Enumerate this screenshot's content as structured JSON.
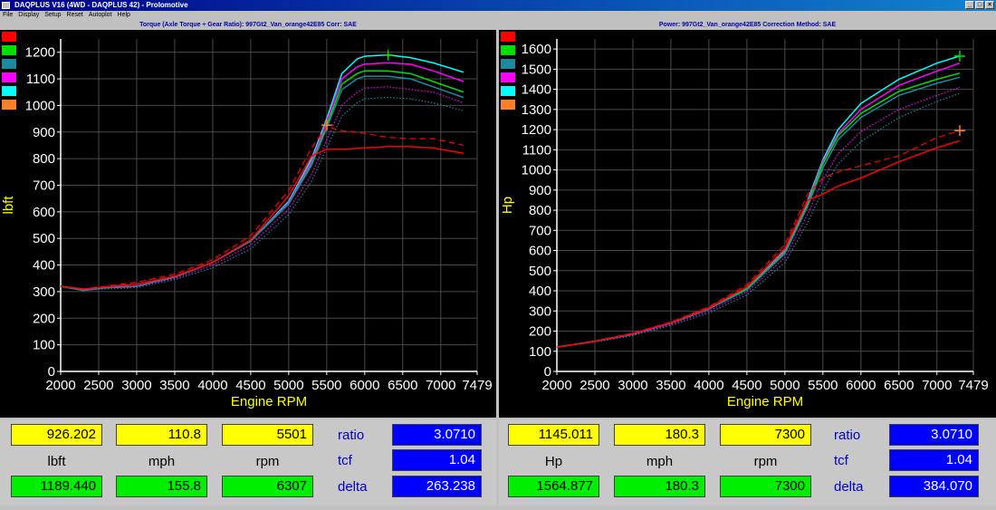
{
  "window": {
    "title": "DAQPLUS V16 (4WD - DAQPLUS 42) - Prolomotive",
    "buttons": [
      "_",
      "□",
      "×"
    ]
  },
  "menu": [
    "File",
    "Display",
    "Setup",
    "Reset",
    "Autoplot",
    "Help"
  ],
  "colors": {
    "red": "#ff0000",
    "green": "#00e000",
    "teal": "#1a8aa0",
    "magenta": "#ff00ff",
    "cyan": "#00ffff",
    "orange": "#ff7f27",
    "axis_label": "#ffff00",
    "tick_label": "#ffffff"
  },
  "swatches": [
    "#ff0000",
    "#00e000",
    "#1a8aa0",
    "#ff00ff",
    "#00ffff",
    "#ff7f27"
  ],
  "torque_chart": {
    "title": "Torque (Axle Torque ÷ Gear Ratio): 997Gt2_Van_orange42E85     Corr: SAE",
    "xlabel": "Engine RPM",
    "ylabel": "lbft"
  },
  "power_chart": {
    "title": "Power: 997Gt2_Van_orange42E85      Correction Method: SAE",
    "xlabel": "Engine RPM",
    "ylabel": "Hp"
  },
  "chart_data": [
    {
      "type": "line",
      "title": "Torque (Axle Torque ÷ Gear Ratio): 997Gt2_Van_orange42E85     Corr: SAE",
      "xlabel": "Engine RPM",
      "ylabel": "lbft",
      "xlim": [
        2000,
        7479
      ],
      "ylim": [
        0,
        1250
      ],
      "xticks": [
        "2000",
        "2500",
        "3000",
        "3500",
        "4000",
        "4500",
        "5000",
        "5500",
        "6000",
        "6500",
        "7000",
        "7479"
      ],
      "yticks": [
        "0",
        "100",
        "200",
        "300",
        "400",
        "500",
        "600",
        "700",
        "800",
        "900",
        "1000",
        "1100",
        "1200"
      ],
      "grid": true,
      "markers": [
        {
          "x": 5501,
          "y": 926,
          "color": "#ff7f27"
        },
        {
          "x": 6307,
          "y": 1189,
          "color": "#00e000"
        }
      ],
      "series": [
        {
          "color": "#00ffff",
          "style": "solid",
          "x": [
            2000,
            2300,
            2600,
            3000,
            3500,
            4000,
            4500,
            5000,
            5300,
            5500,
            5700,
            5900,
            6000,
            6300,
            6600,
            6900,
            7300
          ],
          "y": [
            320,
            305,
            315,
            320,
            355,
            410,
            490,
            640,
            800,
            950,
            1120,
            1175,
            1185,
            1190,
            1180,
            1160,
            1125
          ]
        },
        {
          "color": "#ff00ff",
          "style": "solid",
          "x": [
            2000,
            2300,
            2600,
            3000,
            3500,
            4000,
            4500,
            5000,
            5300,
            5500,
            5700,
            5900,
            6000,
            6300,
            6600,
            6900,
            7300
          ],
          "y": [
            320,
            305,
            315,
            320,
            355,
            410,
            490,
            635,
            790,
            940,
            1100,
            1145,
            1155,
            1160,
            1155,
            1130,
            1090
          ]
        },
        {
          "color": "#00e000",
          "style": "solid",
          "x": [
            2000,
            2300,
            2600,
            3000,
            3500,
            4000,
            4500,
            5000,
            5300,
            5500,
            5700,
            5900,
            6000,
            6300,
            6600,
            6900,
            7300
          ],
          "y": [
            320,
            305,
            315,
            320,
            355,
            410,
            490,
            630,
            780,
            925,
            1080,
            1120,
            1130,
            1130,
            1120,
            1090,
            1050
          ]
        },
        {
          "color": "#1a8aa0",
          "style": "solid",
          "x": [
            2000,
            2300,
            2600,
            3000,
            3500,
            4000,
            4500,
            5000,
            5300,
            5500,
            5700,
            5900,
            6000,
            6300,
            6600,
            6900,
            7300
          ],
          "y": [
            320,
            305,
            315,
            320,
            355,
            410,
            490,
            630,
            775,
            915,
            1060,
            1100,
            1110,
            1110,
            1100,
            1070,
            1030
          ]
        },
        {
          "color": "#ff00ff",
          "style": "dotted",
          "x": [
            2000,
            2300,
            2600,
            3000,
            3500,
            4000,
            4500,
            5000,
            5300,
            5500,
            5700,
            5900,
            6000,
            6300,
            6600,
            6900,
            7300
          ],
          "y": [
            320,
            305,
            315,
            320,
            350,
            400,
            475,
            610,
            740,
            870,
            1000,
            1050,
            1065,
            1070,
            1060,
            1050,
            1010
          ]
        },
        {
          "color": "#1a8aa0",
          "style": "dotted",
          "x": [
            2000,
            2300,
            2600,
            3000,
            3500,
            4000,
            4500,
            5000,
            5300,
            5500,
            5700,
            5900,
            6000,
            6300,
            6600,
            6900,
            7300
          ],
          "y": [
            320,
            305,
            310,
            315,
            345,
            390,
            460,
            590,
            715,
            840,
            960,
            1010,
            1025,
            1030,
            1025,
            1010,
            980
          ]
        },
        {
          "color": "#ff0000",
          "style": "dashed",
          "x": [
            2000,
            2300,
            2600,
            3000,
            3500,
            4000,
            4500,
            5000,
            5300,
            5500,
            5700,
            6000,
            6300,
            6600,
            6900,
            7300
          ],
          "y": [
            320,
            310,
            320,
            335,
            365,
            420,
            510,
            680,
            840,
            920,
            905,
            895,
            880,
            875,
            875,
            850
          ]
        },
        {
          "color": "#ff0000",
          "style": "solid",
          "x": [
            2000,
            2300,
            2600,
            3000,
            3500,
            4000,
            4500,
            5000,
            5300,
            5500,
            5700,
            6000,
            6300,
            6600,
            6900,
            7300
          ],
          "y": [
            320,
            310,
            318,
            328,
            358,
            410,
            495,
            660,
            810,
            835,
            835,
            840,
            845,
            845,
            840,
            820
          ]
        }
      ]
    },
    {
      "type": "line",
      "title": "Power: 997Gt2_Van_orange42E85      Correction Method: SAE",
      "xlabel": "Engine RPM",
      "ylabel": "Hp",
      "xlim": [
        2000,
        7479
      ],
      "ylim": [
        0,
        1650
      ],
      "xticks": [
        "2000",
        "2500",
        "3000",
        "3500",
        "4000",
        "4500",
        "5000",
        "5500",
        "6000",
        "6500",
        "7000",
        "7479"
      ],
      "yticks": [
        "0",
        "100",
        "200",
        "300",
        "400",
        "500",
        "600",
        "700",
        "800",
        "900",
        "1000",
        "1100",
        "1200",
        "1300",
        "1400",
        "1500",
        "1600"
      ],
      "grid": true,
      "markers": [
        {
          "x": 7300,
          "y": 1565,
          "color": "#00e000"
        },
        {
          "x": 7300,
          "y": 1195,
          "color": "#ff7f27"
        }
      ],
      "series": [
        {
          "color": "#00ffff",
          "style": "solid",
          "x": [
            2000,
            2500,
            3000,
            3500,
            4000,
            4500,
            5000,
            5300,
            5500,
            5700,
            6000,
            6500,
            7000,
            7300
          ],
          "y": [
            120,
            150,
            185,
            240,
            310,
            410,
            600,
            850,
            1050,
            1200,
            1330,
            1450,
            1530,
            1565
          ]
        },
        {
          "color": "#ff00ff",
          "style": "solid",
          "x": [
            2000,
            2500,
            3000,
            3500,
            4000,
            4500,
            5000,
            5300,
            5500,
            5700,
            6000,
            6500,
            7000,
            7300
          ],
          "y": [
            120,
            150,
            185,
            240,
            310,
            410,
            595,
            840,
            1040,
            1180,
            1300,
            1420,
            1490,
            1530
          ]
        },
        {
          "color": "#00e000",
          "style": "solid",
          "x": [
            2000,
            2500,
            3000,
            3500,
            4000,
            4500,
            5000,
            5300,
            5500,
            5700,
            6000,
            6500,
            7000,
            7300
          ],
          "y": [
            120,
            150,
            185,
            240,
            310,
            410,
            590,
            830,
            1030,
            1170,
            1280,
            1390,
            1450,
            1480
          ]
        },
        {
          "color": "#1a8aa0",
          "style": "solid",
          "x": [
            2000,
            2500,
            3000,
            3500,
            4000,
            4500,
            5000,
            5300,
            5500,
            5700,
            6000,
            6500,
            7000,
            7300
          ],
          "y": [
            120,
            150,
            185,
            240,
            310,
            405,
            585,
            820,
            1010,
            1150,
            1260,
            1370,
            1430,
            1460
          ]
        },
        {
          "color": "#ff00ff",
          "style": "dotted",
          "x": [
            2000,
            2500,
            3000,
            3500,
            4000,
            4500,
            5000,
            5300,
            5500,
            5700,
            6000,
            6500,
            7000,
            7300
          ],
          "y": [
            120,
            148,
            182,
            235,
            300,
            395,
            565,
            780,
            950,
            1080,
            1190,
            1300,
            1370,
            1410
          ]
        },
        {
          "color": "#1a8aa0",
          "style": "dotted",
          "x": [
            2000,
            2500,
            3000,
            3500,
            4000,
            4500,
            5000,
            5300,
            5500,
            5700,
            6000,
            6500,
            7000,
            7300
          ],
          "y": [
            120,
            145,
            178,
            228,
            290,
            380,
            540,
            740,
            900,
            1030,
            1140,
            1260,
            1340,
            1380
          ]
        },
        {
          "color": "#ff0000",
          "style": "dashed",
          "x": [
            2000,
            2500,
            3000,
            3500,
            4000,
            4500,
            5000,
            5300,
            5500,
            5700,
            6000,
            6500,
            7000,
            7300
          ],
          "y": [
            120,
            150,
            190,
            245,
            320,
            430,
            630,
            880,
            960,
            990,
            1020,
            1070,
            1160,
            1195
          ]
        },
        {
          "color": "#ff0000",
          "style": "solid",
          "x": [
            2000,
            2500,
            3000,
            3500,
            4000,
            4500,
            5000,
            5300,
            5500,
            5700,
            6000,
            6500,
            7000,
            7300
          ],
          "y": [
            120,
            150,
            188,
            242,
            315,
            420,
            610,
            850,
            880,
            920,
            960,
            1040,
            1110,
            1145
          ]
        }
      ]
    }
  ],
  "left_readout": {
    "cursor_values": [
      "926.202",
      "110.8",
      "5501"
    ],
    "units": [
      "lbft",
      "mph",
      "rpm"
    ],
    "peak_values": [
      "1189.440",
      "155.8",
      "6307"
    ],
    "param_labels": [
      "ratio",
      "tcf",
      "delta"
    ],
    "param_values": [
      "3.0710",
      "1.04",
      "263.238"
    ]
  },
  "right_readout": {
    "cursor_values": [
      "1145.011",
      "180.3",
      "7300"
    ],
    "units": [
      "Hp",
      "mph",
      "rpm"
    ],
    "peak_values": [
      "1564.877",
      "180.3",
      "7300"
    ],
    "param_labels": [
      "ratio",
      "tcf",
      "delta"
    ],
    "param_values": [
      "3.0710",
      "1.04",
      "384.070"
    ]
  }
}
